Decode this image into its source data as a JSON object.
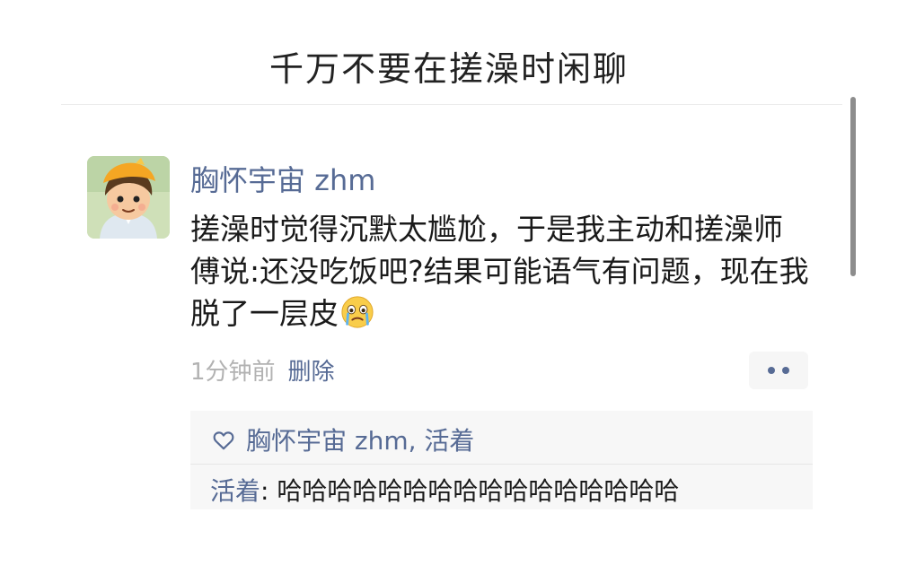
{
  "title": "千万不要在搓澡时闲聊",
  "post": {
    "nickname": "胸怀宇宙 zhm",
    "content": "搓澡时觉得沉默太尴尬，于是我主动和搓澡师傅说:还没吃饭吧?结果可能语气有问题，现在我脱了一层皮",
    "emoji": "crying-face-icon",
    "time": "1分钟前",
    "delete_label": "删除"
  },
  "likes": {
    "icon": "heart-outline-icon",
    "names": "胸怀宇宙 zhm, 活着"
  },
  "comments": [
    {
      "author": "活着",
      "separator": ": ",
      "text": "哈哈哈哈哈哈哈哈哈哈哈哈哈哈哈哈"
    }
  ],
  "colors": {
    "link": "#576b95",
    "text": "#1a1a1a",
    "meta": "#b2b2b2",
    "comment_bg": "#f7f7f7"
  }
}
